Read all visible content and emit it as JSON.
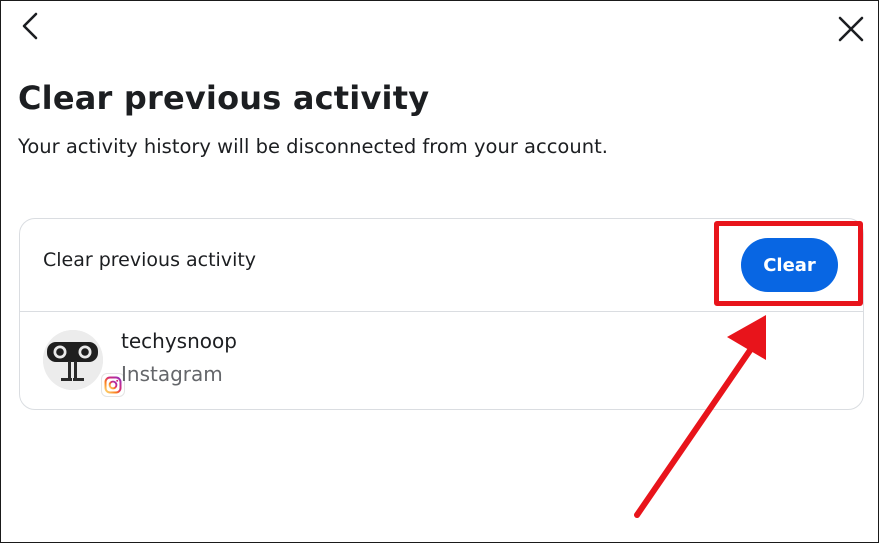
{
  "header": {
    "back_icon": "chevron-left-icon",
    "close_icon": "close-icon"
  },
  "page": {
    "title": "Clear previous activity",
    "subtitle": "Your activity history will be disconnected from your account."
  },
  "card": {
    "header_label": "Clear previous activity",
    "clear_button_label": "Clear",
    "account": {
      "username": "techysnoop",
      "platform": "Instagram",
      "badge_icon": "instagram-icon"
    }
  },
  "annotation": {
    "color": "#e8141b"
  },
  "colors": {
    "accent": "#0866e3",
    "text": "#1c1e21",
    "secondary_text": "#65676b",
    "border": "#dadde1"
  }
}
